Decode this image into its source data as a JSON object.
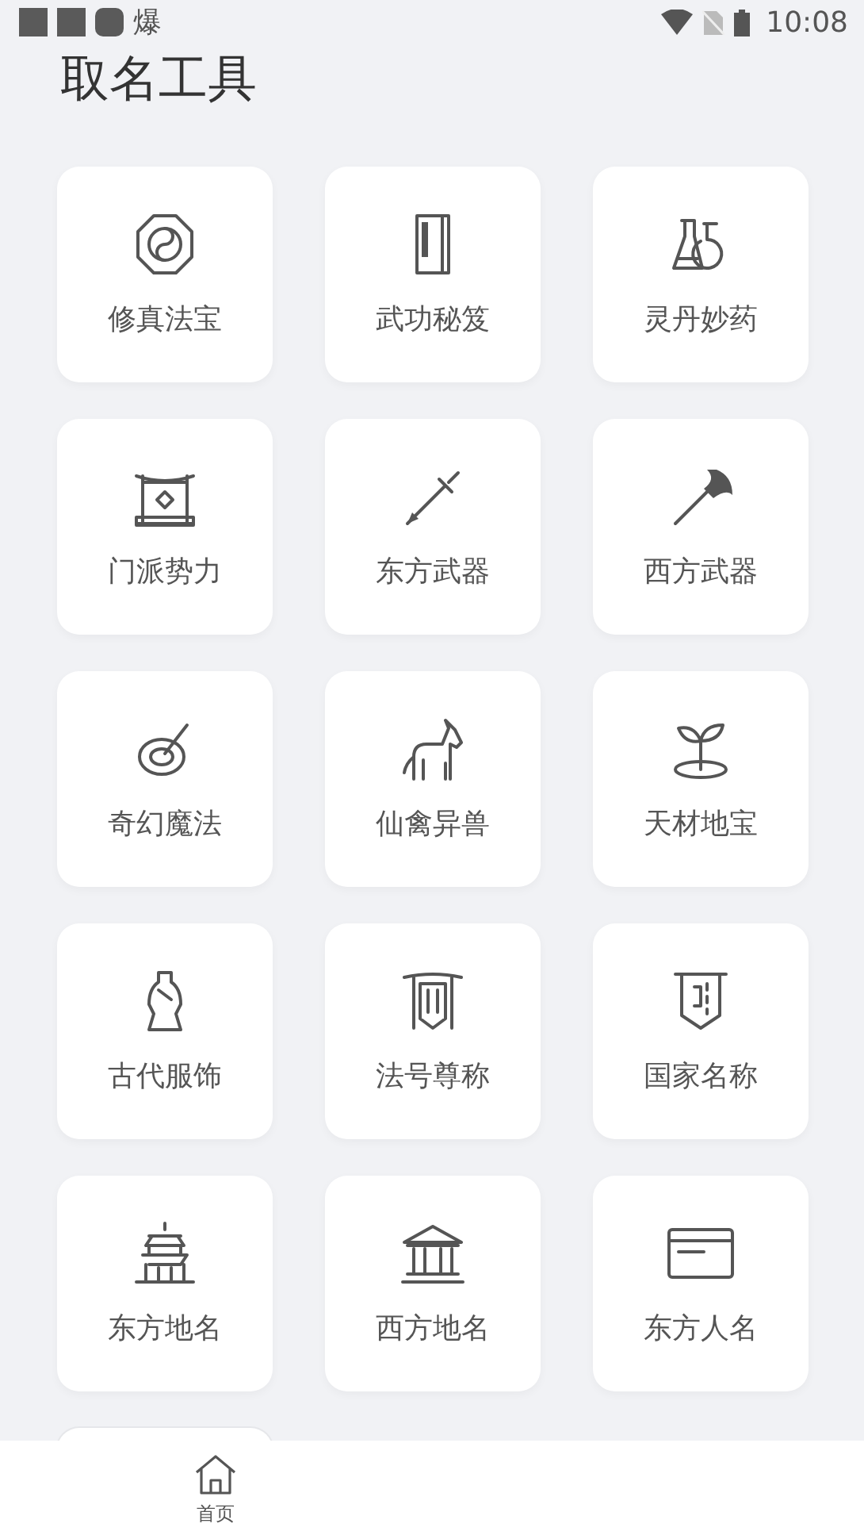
{
  "status_bar": {
    "notifications": [
      "爆"
    ],
    "time": "10:08"
  },
  "title": "取名工具",
  "tools": [
    {
      "label": "修真法宝"
    },
    {
      "label": "武功秘笈"
    },
    {
      "label": "灵丹妙药"
    },
    {
      "label": "门派势力"
    },
    {
      "label": "东方武器"
    },
    {
      "label": "西方武器"
    },
    {
      "label": "奇幻魔法"
    },
    {
      "label": "仙禽异兽"
    },
    {
      "label": "天材地宝"
    },
    {
      "label": "古代服饰"
    },
    {
      "label": "法号尊称"
    },
    {
      "label": "国家名称"
    },
    {
      "label": "东方地名"
    },
    {
      "label": "西方地名"
    },
    {
      "label": "东方人名"
    },
    {
      "kind": "cut_off"
    }
  ],
  "bottom_nav": [
    {
      "label": "首页"
    }
  ]
}
